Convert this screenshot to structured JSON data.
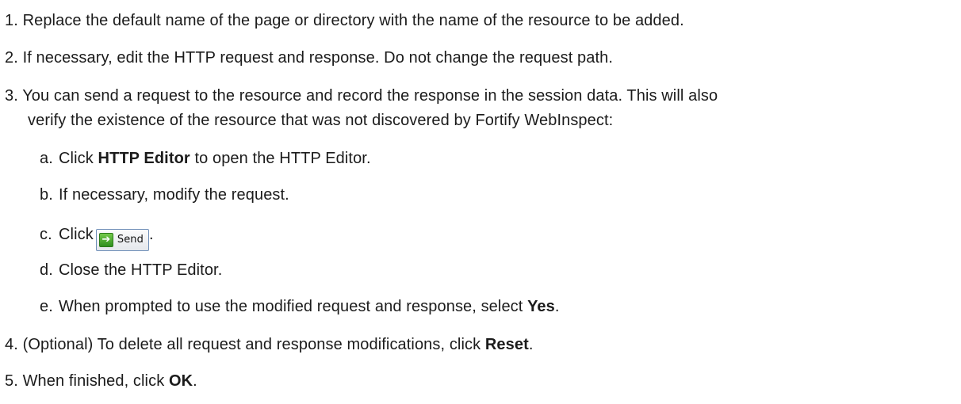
{
  "steps": [
    {
      "num": "1.",
      "text": "Replace the default name of the page or directory with the name of the resource to be added."
    },
    {
      "num": "2.",
      "text": "If necessary, edit the HTTP request and response. Do not change the request path."
    },
    {
      "num": "3.",
      "line1": "You can send a request to the resource and record the response in the session data. This will also",
      "line2": "verify the existence of the resource that was not discovered by Fortify WebInspect:"
    },
    {
      "num": "4.",
      "pre": "(Optional) To delete all request and response modifications, click ",
      "bold": "Reset",
      "post": "."
    },
    {
      "num": "5.",
      "pre": "When finished, click ",
      "bold": "OK",
      "post": "."
    }
  ],
  "substeps": [
    {
      "letter": "a.",
      "pre": "Click ",
      "bold": "HTTP Editor",
      "post": " to open the HTTP Editor."
    },
    {
      "letter": "b.",
      "text": "If necessary, modify the request."
    },
    {
      "letter": "c.",
      "pre": "Click",
      "button_label": "Send",
      "button_icon": "green-arrow-right-icon",
      "post": "."
    },
    {
      "letter": "d.",
      "text": "Close the HTTP Editor."
    },
    {
      "letter": "e.",
      "pre": "When prompted to use the modified request and response, select ",
      "bold": "Yes",
      "post": "."
    }
  ]
}
